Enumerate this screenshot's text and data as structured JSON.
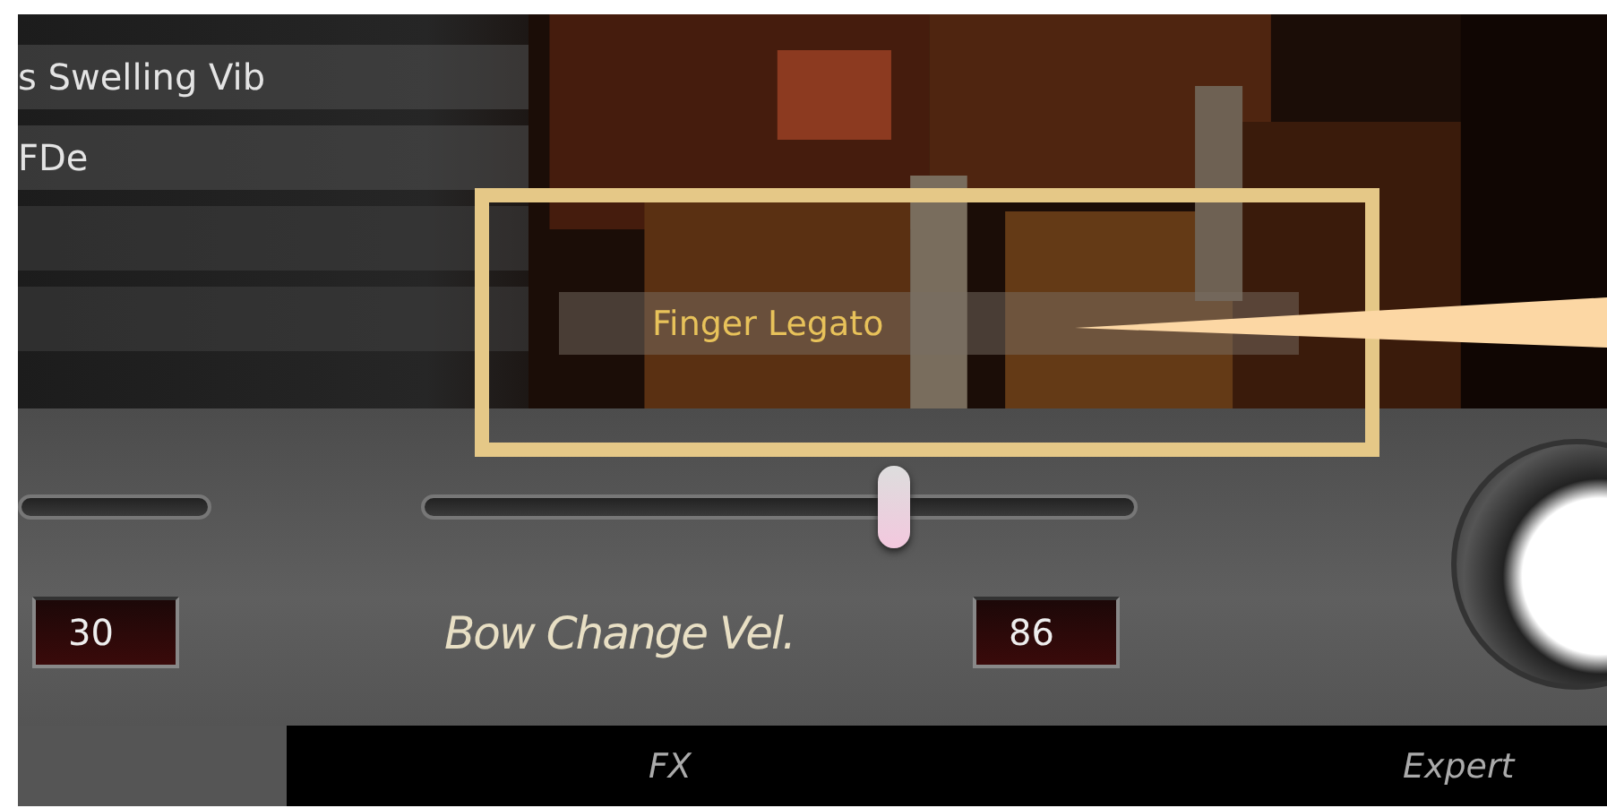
{
  "articulation_list": [
    {
      "label": "s Swelling Vib"
    },
    {
      "label": "FDe"
    }
  ],
  "selected_articulation": {
    "label": "Finger Legato"
  },
  "controls": [
    {
      "kind": "slider",
      "reading": "30"
    },
    {
      "kind": "slider",
      "label": "Bow Change Vel.",
      "level": 0.66,
      "reading": "86"
    }
  ],
  "tabs": [
    {
      "label": "FX"
    },
    {
      "label": "Expert"
    }
  ]
}
